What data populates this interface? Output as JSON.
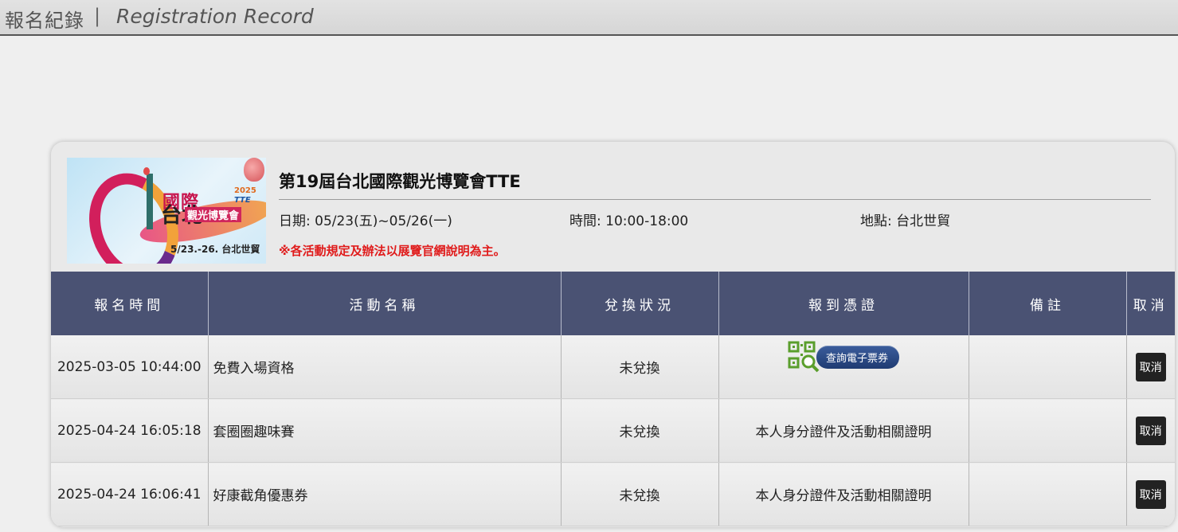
{
  "header": {
    "title_zh": "報名紀錄",
    "separator": "|",
    "title_en": "Registration Record"
  },
  "event": {
    "banner": {
      "main_text": "國際",
      "year": "2025",
      "tte": "TTE",
      "sub_text": "觀光博覽會",
      "city": "台北",
      "dates": "5/23.-26. 台北世貿"
    },
    "title": "第19屆台北國際觀光博覽會TTE",
    "date_label": "日期: 05/23(五)~05/26(一)",
    "time_label": "時間: 10:00-18:00",
    "place_label": "地點: 台北世貿",
    "notice": "※各活動規定及辦法以展覽官網說明為主。"
  },
  "table": {
    "headers": [
      "報名時間",
      "活動名稱",
      "兌換狀況",
      "報到憑證",
      "備註",
      "取消"
    ],
    "rows": [
      {
        "time": "2025-03-05 10:44:00",
        "name": "免費入場資格",
        "status": "未兌換",
        "voucher_type": "button",
        "voucher": "查詢電子票券",
        "note": "",
        "cancel": "取消"
      },
      {
        "time": "2025-04-24 16:05:18",
        "name": "套圈圈趣味賽",
        "status": "未兌換",
        "voucher_type": "text",
        "voucher": "本人身分證件及活動相關證明",
        "note": "",
        "cancel": "取消"
      },
      {
        "time": "2025-04-24 16:06:41",
        "name": "好康截角優惠券",
        "status": "未兌換",
        "voucher_type": "text",
        "voucher": "本人身分證件及活動相關證明",
        "note": "",
        "cancel": "取消"
      }
    ]
  },
  "colors": {
    "table_header_bg": "#4a5273",
    "notice": "#e01b1b",
    "ticket_button": "#1f3b72",
    "qr_icon": "#5a9e2c"
  },
  "icons": {
    "ticket": "qr-code-magnifier-icon"
  }
}
